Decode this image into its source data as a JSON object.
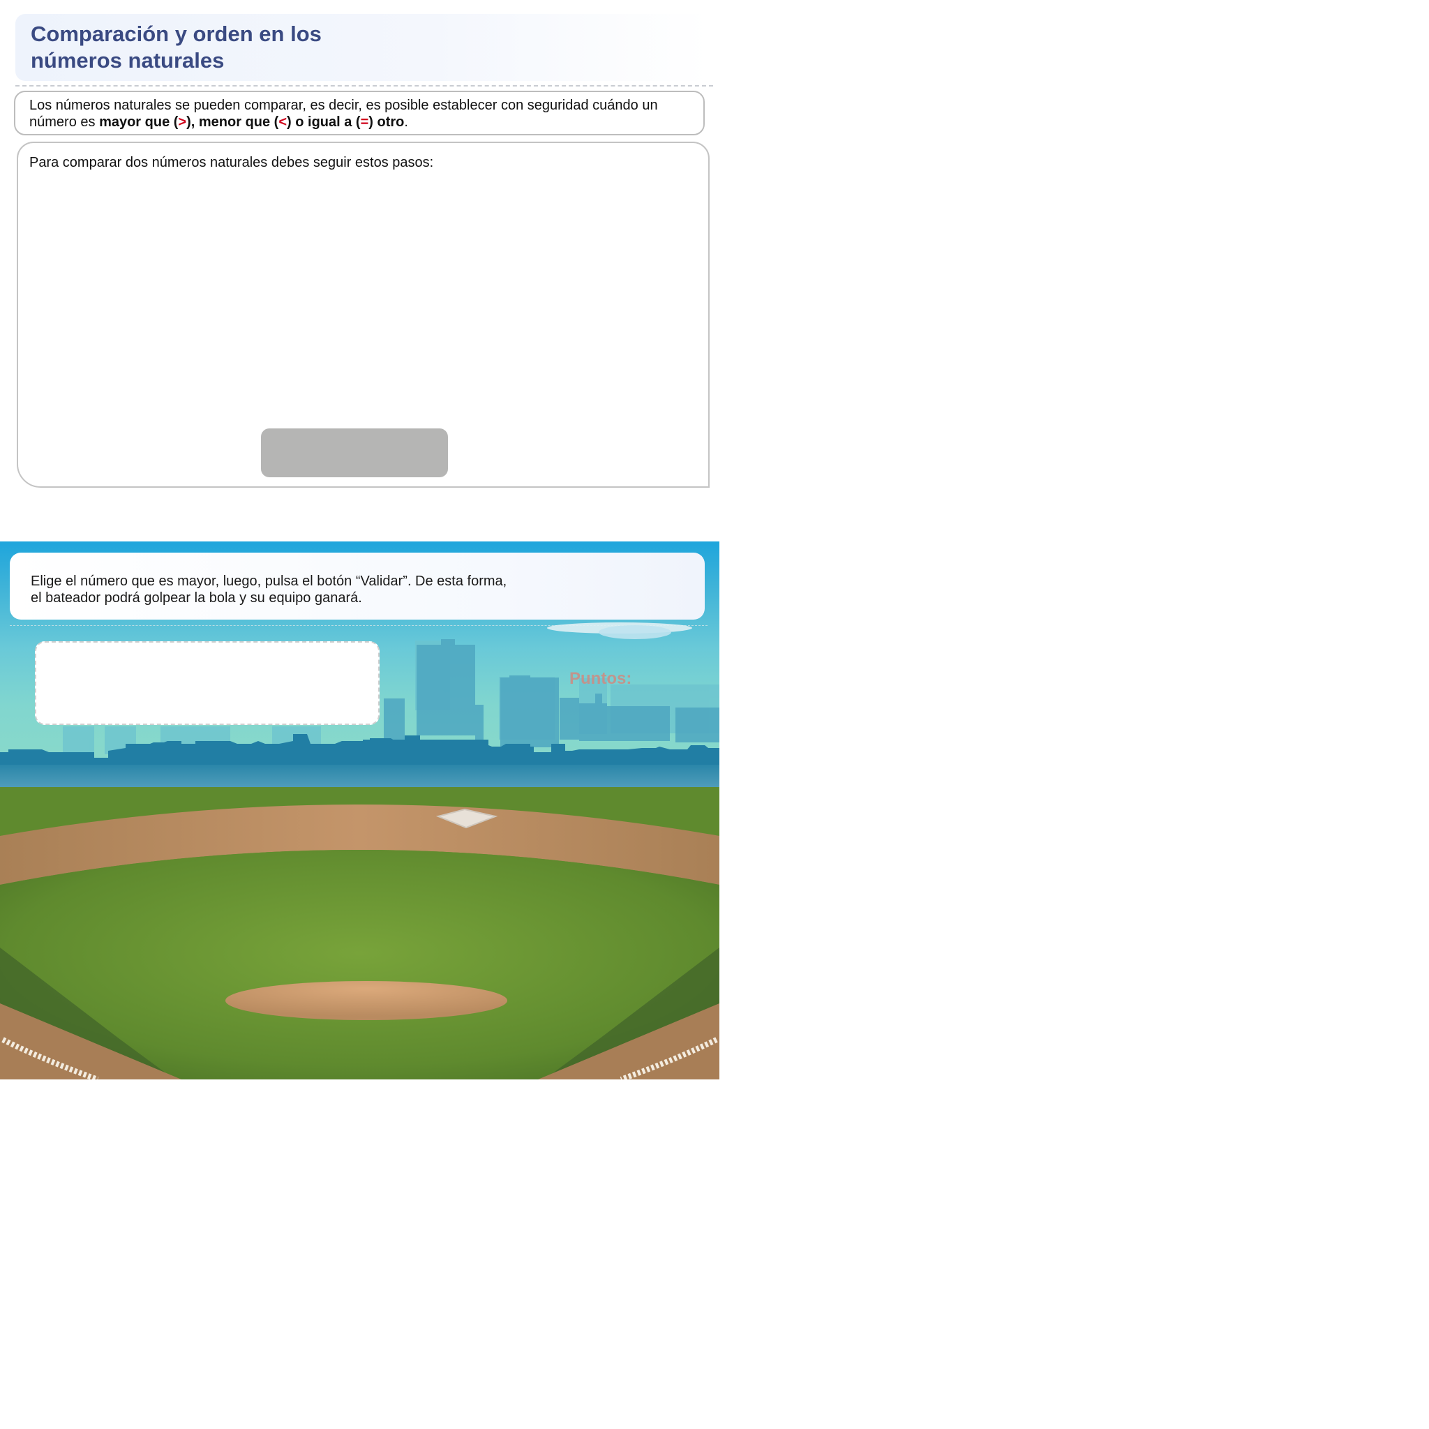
{
  "lesson": {
    "title_line1": "Comparación y orden en los",
    "title_line2": "números naturales",
    "intro": {
      "text_before": "Los números naturales se pueden comparar, es decir, es posible establecer con seguridad cuándo un número es ",
      "mayor_que": "mayor que (",
      "gt_symbol": ">",
      "menor_que": "), menor que (",
      "lt_symbol": "<",
      "igual_a": ") o igual a (",
      "eq_symbol": "=",
      "otro": ") otro",
      "period": "."
    },
    "steps_text": "Para comparar dos números naturales debes seguir estos pasos:"
  },
  "game": {
    "instruction_line1": "Elige el número que es mayor, luego, pulsa el botón “Validar”. De esta forma,",
    "instruction_line2": "el bateador podrá golpear la bola y su equipo ganará.",
    "score_label": "Puntos:"
  },
  "colors": {
    "title": "#3a4a82",
    "symbol": "#d0021b",
    "sky_top": "#1ea5dc",
    "grass": "#6a9a35",
    "dirt": "#c49465",
    "score_label": "#c98f86"
  }
}
